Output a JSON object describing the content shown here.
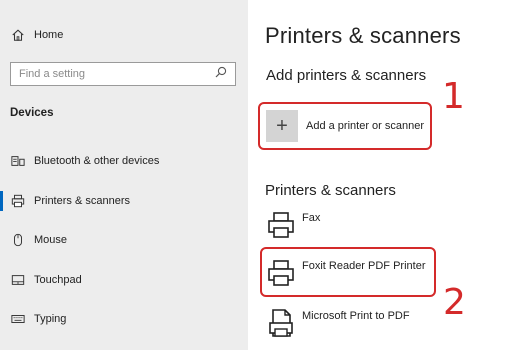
{
  "sidebar": {
    "home_label": "Home",
    "search_placeholder": "Find a setting",
    "section_title": "Devices",
    "items": [
      {
        "label": "Bluetooth & other devices",
        "icon": "bluetooth-devices-icon"
      },
      {
        "label": "Printers & scanners",
        "icon": "printer-icon",
        "selected": true
      },
      {
        "label": "Mouse",
        "icon": "mouse-icon"
      },
      {
        "label": "Touchpad",
        "icon": "touchpad-icon"
      },
      {
        "label": "Typing",
        "icon": "keyboard-icon"
      }
    ]
  },
  "main": {
    "title": "Printers & scanners",
    "add_section_title": "Add printers & scanners",
    "add_button_label": "Add a printer or scanner",
    "list_section_title": "Printers & scanners",
    "printers": [
      {
        "label": "Fax",
        "icon": "printer-icon"
      },
      {
        "label": "Foxit Reader PDF Printer",
        "icon": "printer-icon"
      },
      {
        "label": "Microsoft Print to PDF",
        "icon": "pdf-printer-icon"
      }
    ]
  },
  "annotations": [
    {
      "number": "1",
      "color": "#d42a2a"
    },
    {
      "number": "2",
      "color": "#d42a2a"
    }
  ],
  "colors": {
    "accent": "#0067c0",
    "sidebar_bg": "#ededed",
    "annotation": "#d42a2a"
  }
}
